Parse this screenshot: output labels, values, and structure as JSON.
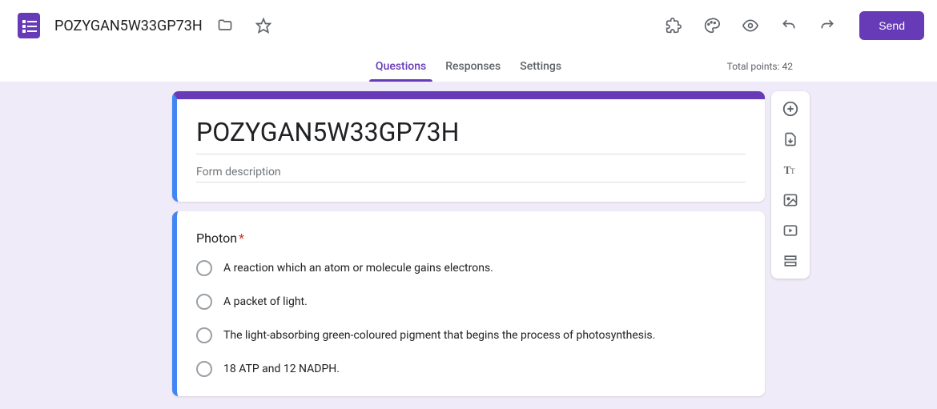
{
  "header": {
    "doc_title": "POZYGAN5W33GP73H",
    "send_label": "Send"
  },
  "tabs": {
    "questions": "Questions",
    "responses": "Responses",
    "settings": "Settings"
  },
  "points_label": "Total points: 42",
  "form": {
    "title": "POZYGAN5W33GP73H",
    "description_placeholder": "Form description"
  },
  "question": {
    "title": "Photon",
    "required": true,
    "options": [
      "A reaction which an atom or molecule gains electrons.",
      "A packet of light.",
      "The light-absorbing green-coloured pigment that begins the process of photosynthesis.",
      "18 ATP and 12 NADPH."
    ]
  }
}
